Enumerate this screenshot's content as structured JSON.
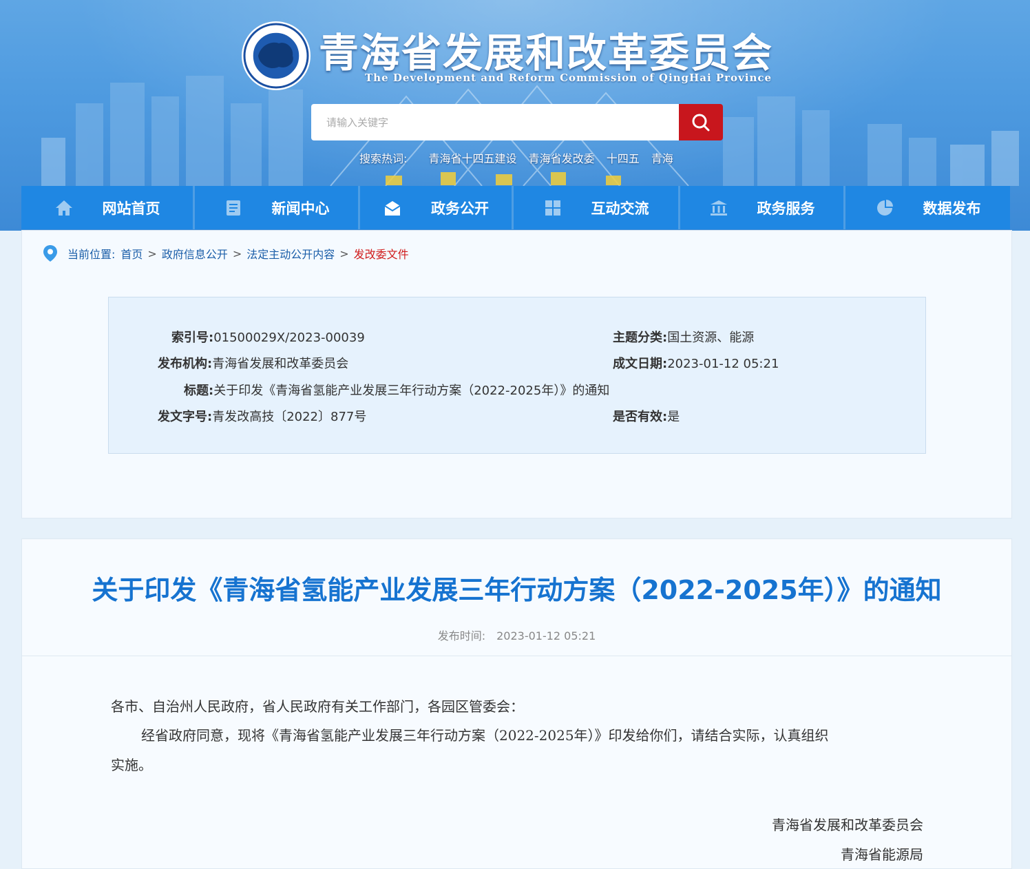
{
  "header": {
    "title_cn": "青海省发展和改革委员会",
    "title_en": "The Development and Reform Commission of QingHai Province",
    "search_placeholder": "请输入关键字",
    "hot_label": "搜索热词:",
    "hot_keywords": [
      "青海省十四五建设",
      "青海省发改委",
      "十四五",
      "青海"
    ]
  },
  "nav": [
    {
      "label": "网站首页",
      "icon": "home-icon"
    },
    {
      "label": "新闻中心",
      "icon": "newspaper-icon"
    },
    {
      "label": "政务公开",
      "icon": "mailbox-icon"
    },
    {
      "label": "互动交流",
      "icon": "grid-icon"
    },
    {
      "label": "政务服务",
      "icon": "bank-icon"
    },
    {
      "label": "数据发布",
      "icon": "pie-chart-icon"
    }
  ],
  "breadcrumb": {
    "prefix": "当前位置:",
    "items": [
      "首页",
      "政府信息公开",
      "法定主动公开内容",
      "发改委文件"
    ],
    "separator": ">"
  },
  "meta": {
    "index_label": "索引号:",
    "index_value": "01500029X/2023-00039",
    "topic_label": "主题分类:",
    "topic_value": "国土资源、能源",
    "org_label": "发布机构:",
    "org_value": "青海省发展和改革委员会",
    "date_label": "成文日期:",
    "date_value": "2023-01-12 05:21",
    "title_label": "标题:",
    "title_value": "关于印发《青海省氢能产业发展三年行动方案（2022-2025年）》的通知",
    "docno_label": "发文字号:",
    "docno_value": "青发改高技〔2022〕877号",
    "valid_label": "是否有效:",
    "valid_value": "是"
  },
  "article": {
    "title": "关于印发《青海省氢能产业发展三年行动方案（2022-2025年）》的通知",
    "pubtime_label": "发布时间:",
    "pubtime_value": "2023-01-12 05:21",
    "salutation": "各市、自治州人民政府，省人民政府有关工作部门，各园区管委会：",
    "para1_line1": "经省政府同意，现将《青海省氢能产业发展三年行动方案（2022-2025年）》印发给你们，请结合实际，认真组织",
    "para1_line2": "实施。",
    "signature1": "青海省发展和改革委员会",
    "signature2": "青海省能源局"
  },
  "colors": {
    "nav_bg": "#1f87e3",
    "search_button": "#c8161d",
    "title_blue": "#1673d0",
    "breadcrumb_current": "#d01b1b"
  }
}
